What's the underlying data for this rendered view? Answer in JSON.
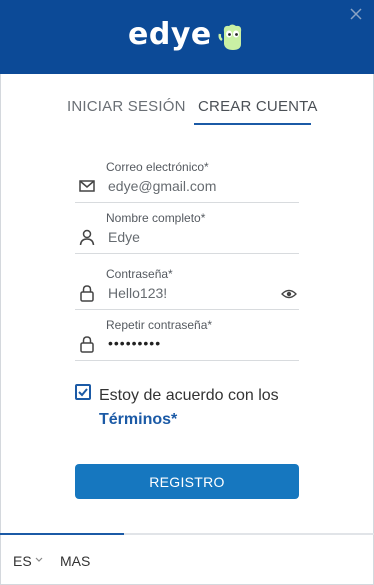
{
  "header": {
    "logo_text": "edye",
    "brand_color": "#0c4a97"
  },
  "tabs": [
    {
      "label": "INICIAR SESIÓN",
      "active": false
    },
    {
      "label": "CREAR CUENTA",
      "active": true
    }
  ],
  "form": {
    "email": {
      "label": "Correo electrónico*",
      "value": "edye@gmail.com",
      "icon": "mail-icon"
    },
    "name": {
      "label": "Nombre completo*",
      "value": "Edye",
      "icon": "user-icon"
    },
    "password": {
      "label": "Contraseña*",
      "value": "Hello123!",
      "icon": "lock-icon"
    },
    "repeat_password": {
      "label": "Repetir contraseña*",
      "value": "•••••••••",
      "icon": "lock-icon"
    }
  },
  "agreement": {
    "checked": true,
    "text": "Estoy de acuerdo con los",
    "terms_link": "Términos",
    "required_mark": "*"
  },
  "register_button": {
    "label": "REGISTRO",
    "color": "#1677bf"
  },
  "footer": {
    "language": "ES",
    "more": "MAS"
  }
}
